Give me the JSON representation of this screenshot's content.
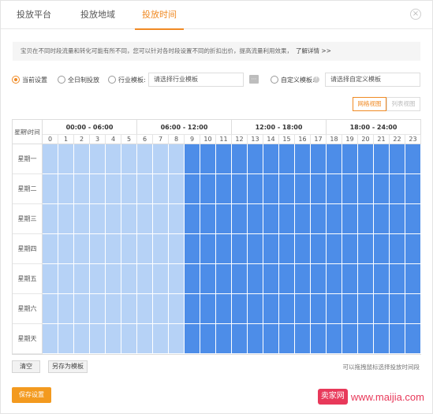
{
  "tabs": [
    {
      "label": "投放平台",
      "active": false
    },
    {
      "label": "投放地域",
      "active": false
    },
    {
      "label": "投放时间",
      "active": true
    }
  ],
  "close_icon": "close-circle-icon",
  "tip": {
    "text": "宝贝在不同时段流量和转化可能有所不同，您可以针对各时段设置不同的折扣出价，提高流量利用效果，",
    "link": "了解详情 >>"
  },
  "options": {
    "current": "当前设置",
    "all_day": "全日制投放",
    "industry": "行业模板:",
    "industry_placeholder": "请选择行业模板",
    "custom": "自定义模板:",
    "custom_placeholder": "请选择自定义模板",
    "selected": "current"
  },
  "view": {
    "grid": "网格视图",
    "list": "列表视图",
    "active": "grid"
  },
  "grid": {
    "corner": "星期\\时间",
    "slots": [
      "00:00 - 06:00",
      "06:00 - 12:00",
      "12:00 - 18:00",
      "18:00 - 24:00"
    ],
    "hours": [
      "0",
      "1",
      "2",
      "3",
      "4",
      "5",
      "6",
      "7",
      "8",
      "9",
      "10",
      "11",
      "12",
      "13",
      "14",
      "15",
      "16",
      "17",
      "18",
      "19",
      "20",
      "21",
      "22",
      "23"
    ],
    "days": [
      "星期一",
      "星期二",
      "星期三",
      "星期四",
      "星期五",
      "星期六",
      "星期天"
    ],
    "light_hours": [
      0,
      1,
      2,
      3,
      4,
      5,
      6,
      7,
      8
    ],
    "dark_hours": [
      9,
      10,
      11,
      12,
      13,
      14,
      15,
      16,
      17,
      18,
      19,
      20,
      21,
      22,
      23
    ],
    "colors": {
      "light": "#b6d2f6",
      "dark": "#4d8de8"
    }
  },
  "actions": {
    "clear": "清空",
    "save_template": "另存为模板",
    "hint": "可以拖拽鼠标选择投放时间段",
    "save": "保存设置"
  },
  "accent": "#f08a24",
  "watermark": {
    "logo": "卖家网",
    "url": "www.maijia.com"
  }
}
